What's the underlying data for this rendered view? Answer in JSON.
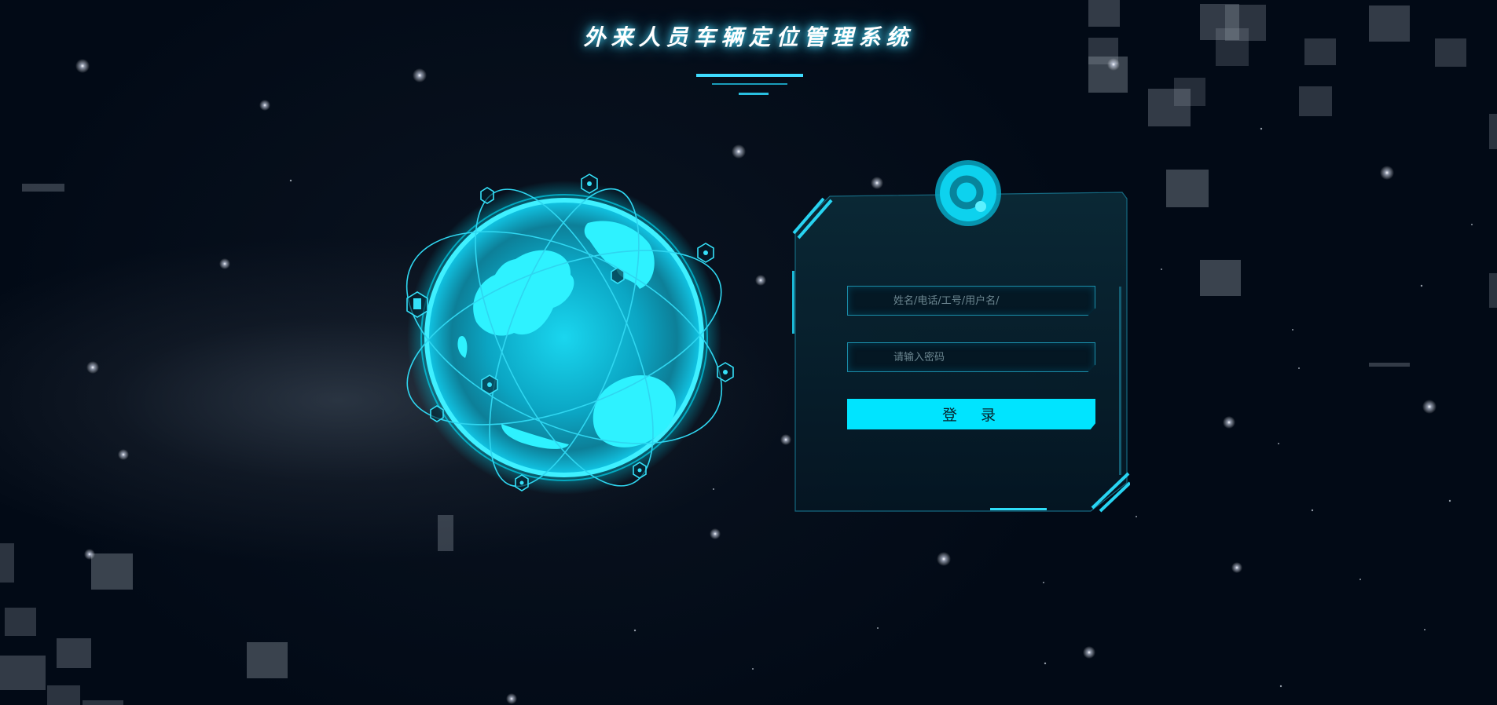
{
  "header": {
    "title": "外来人员车辆定位管理系统"
  },
  "login": {
    "username_placeholder": "姓名/电话/工号/用户名/",
    "username_value": "",
    "password_placeholder": "请输入密码",
    "password_value": "",
    "submit_label": "登 录"
  },
  "icons": {
    "logo": "circular-q-logo-icon",
    "globe": "globe-network-icon"
  },
  "colors": {
    "accent": "#00e4ff",
    "background": "#020a16",
    "border": "#1a8ca8"
  }
}
